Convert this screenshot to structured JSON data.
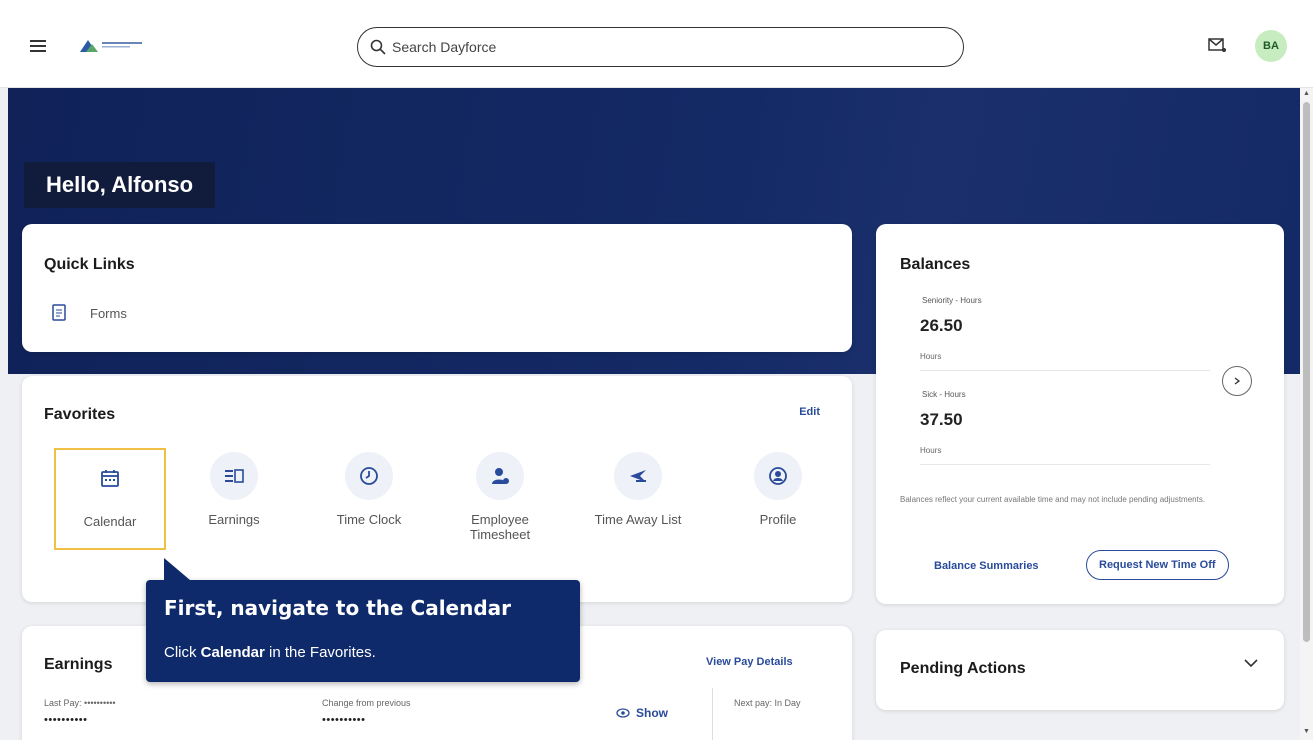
{
  "header": {
    "search_placeholder": "Search Dayforce",
    "avatar_initials": "BA"
  },
  "hero": {
    "greeting": "Hello, Alfonso"
  },
  "quick_links": {
    "title": "Quick Links",
    "items": [
      {
        "label": "Forms",
        "icon": "form-icon"
      }
    ]
  },
  "favorites": {
    "title": "Favorites",
    "edit_label": "Edit",
    "items": [
      {
        "label": "Calendar",
        "icon": "calendar-icon"
      },
      {
        "label": "Earnings",
        "icon": "earnings-icon"
      },
      {
        "label": "Time Clock",
        "icon": "clock-icon"
      },
      {
        "label": "Employee Timesheet",
        "icon": "employee-icon"
      },
      {
        "label": "Time Away List",
        "icon": "airplane-icon"
      },
      {
        "label": "Profile",
        "icon": "profile-icon"
      }
    ]
  },
  "earnings": {
    "title": "Earnings",
    "view_pay_details": "View Pay Details",
    "last_pay_label": "Last Pay:",
    "last_pay_mask": "••••••••••",
    "last_pay_mask2": "••••••••••",
    "change_label": "Change from previous",
    "change_mask": "••••••••••",
    "show_label": "Show",
    "next_pay_label": "Next pay: In Day"
  },
  "balances": {
    "title": "Balances",
    "items": [
      {
        "label": "Seniority - Hours",
        "value": "26.50",
        "unit": "Hours"
      },
      {
        "label": "Sick - Hours",
        "value": "37.50",
        "unit": "Hours"
      }
    ],
    "note": "Balances reflect your current available time and may not include pending adjustments.",
    "summaries_label": "Balance Summaries",
    "request_label": "Request New Time Off"
  },
  "pending": {
    "title": "Pending Actions"
  },
  "tooltip": {
    "title": "First, navigate to the Calendar",
    "body_pre": "Click",
    "body_bold": "Calendar",
    "body_post": "in the Favorites."
  },
  "colors": {
    "accent": "#2a4b9b",
    "hero": "#142a66",
    "highlight": "#f0c044"
  }
}
